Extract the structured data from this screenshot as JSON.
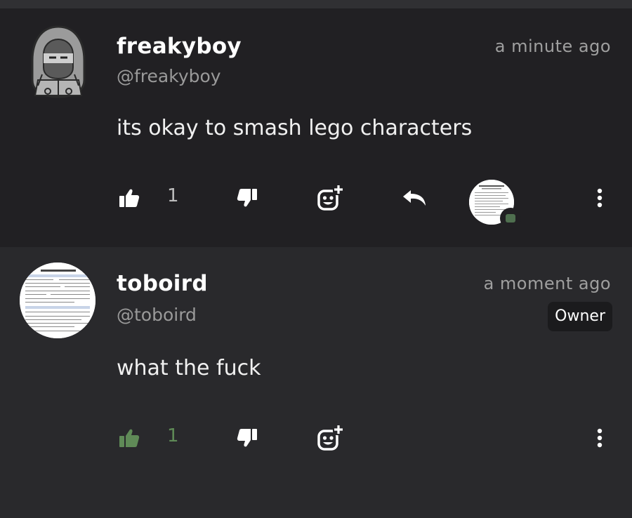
{
  "comments": [
    {
      "username": "freakyboy",
      "handle": "@freakyboy",
      "time": "a minute ago",
      "text": "its okay to smash lego characters",
      "likes": "1",
      "liked": false,
      "has_reply_avatar": true,
      "avatar_icon": "hooded-character-avatar",
      "reaction_icons": [
        "thumbs-up-icon",
        "thumbs-down-icon",
        "add-reaction-icon",
        "reply-icon",
        "more-icon"
      ]
    },
    {
      "username": "toboird",
      "handle": "@toboird",
      "time": "a moment ago",
      "badge": "Owner",
      "text": "what the fuck",
      "likes": "1",
      "liked": true,
      "avatar_icon": "job-application-document-avatar",
      "reaction_icons": [
        "thumbs-up-icon",
        "thumbs-down-icon",
        "add-reaction-icon",
        "more-icon"
      ]
    }
  ],
  "colors": {
    "background_first": "#212023",
    "background_second": "#29292c",
    "liked_green": "#5f8a57",
    "text_primary": "#ffffff",
    "text_secondary": "#9a9a9a"
  }
}
